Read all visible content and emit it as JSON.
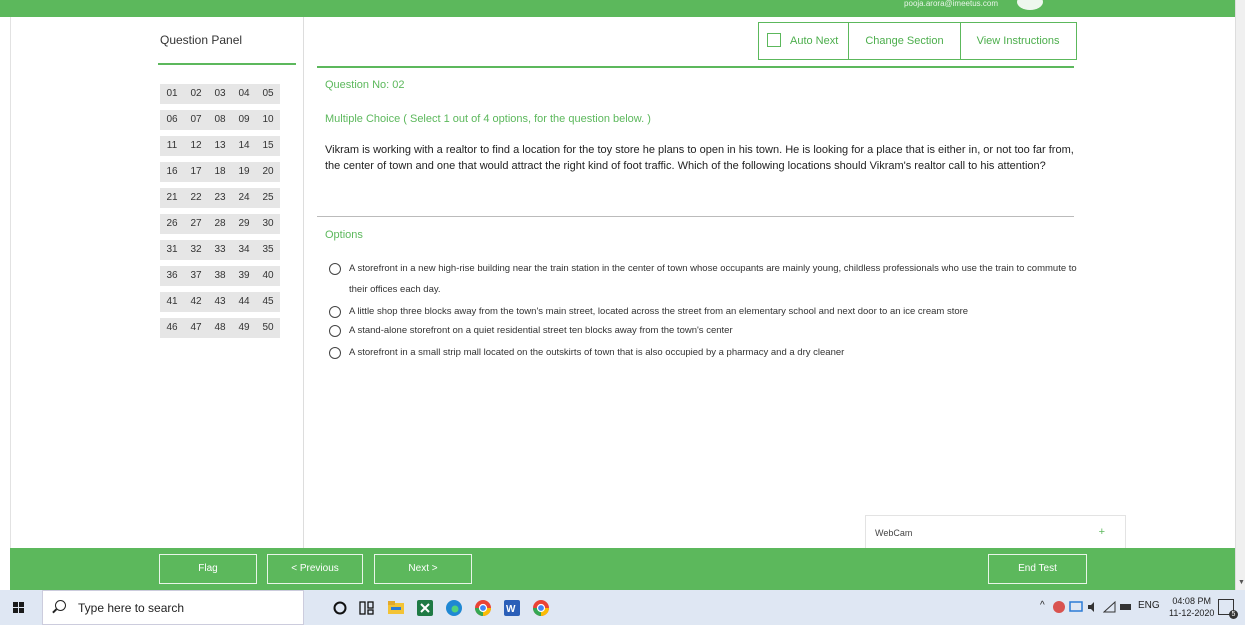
{
  "header": {
    "user_email": "pooja.arora@imeetus.com"
  },
  "question_panel": {
    "title": "Question Panel",
    "rows": [
      [
        "01",
        "02",
        "03",
        "04",
        "05"
      ],
      [
        "06",
        "07",
        "08",
        "09",
        "10"
      ],
      [
        "11",
        "12",
        "13",
        "14",
        "15"
      ],
      [
        "16",
        "17",
        "18",
        "19",
        "20"
      ],
      [
        "21",
        "22",
        "23",
        "24",
        "25"
      ],
      [
        "26",
        "27",
        "28",
        "29",
        "30"
      ],
      [
        "31",
        "32",
        "33",
        "34",
        "35"
      ],
      [
        "36",
        "37",
        "38",
        "39",
        "40"
      ],
      [
        "41",
        "42",
        "43",
        "44",
        "45"
      ],
      [
        "46",
        "47",
        "48",
        "49",
        "50"
      ]
    ]
  },
  "toolbar": {
    "auto_next": "Auto Next",
    "change_section": "Change Section",
    "view_instructions": "View Instructions"
  },
  "question": {
    "number_label": "Question No: 02",
    "type_label": "Multiple Choice ( Select 1 out of 4 options, for the question below. )",
    "text": "Vikram is working with a realtor to find a location for the toy store he plans to open in his town. He is looking for a place that is either in, or not too far from, the center of town and one that would attract the right kind of foot traffic. Which of the following locations should Vikram's realtor call to his attention?",
    "options_label": "Options",
    "options": [
      "A storefront in a new high-rise building near the train station in the center of town whose occupants are mainly young, childless professionals who use the train to commute to their offices each day.",
      "A little shop three blocks away from the town's main street, located across the street from an elementary school and next door to an ice cream store",
      " A stand-alone storefront on a quiet residential street ten blocks away from the town's center",
      "A storefront in a small strip mall located on the outskirts of town that is also occupied by a pharmacy and a dry cleaner"
    ]
  },
  "webcam": {
    "label": "WebCam",
    "toggle": "+"
  },
  "footer": {
    "flag": "Flag",
    "previous": "< Previous",
    "next": "Next >",
    "end_test": "End Test"
  },
  "taskbar": {
    "search_placeholder": "Type here to search",
    "language": "ENG",
    "time": "04:08 PM",
    "date": "11-12-2020",
    "notification_count": "5"
  }
}
